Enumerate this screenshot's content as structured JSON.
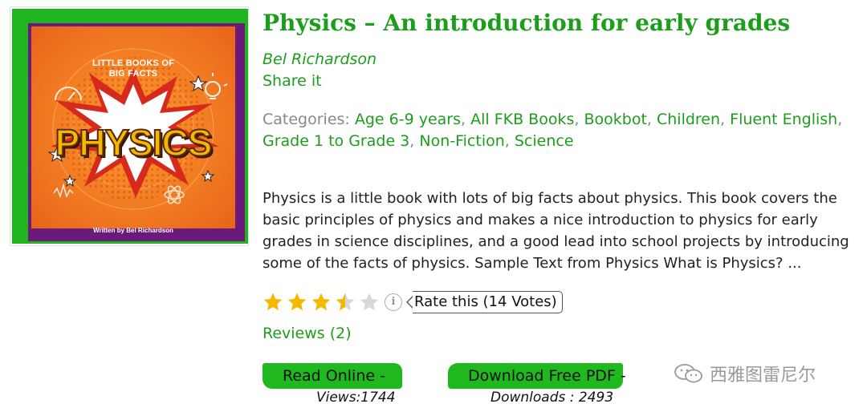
{
  "cover": {
    "series_line1": "LITTLE BOOKS OF",
    "series_line2": "BIG FACTS",
    "title": "PHYSICS",
    "author_line": "Written by Bel Richardson"
  },
  "book": {
    "title": "Physics – An introduction for early grades",
    "author": "Bel Richardson",
    "share_label": "Share it"
  },
  "categories": {
    "label": "Categories:",
    "items": [
      "Age 6-9 years",
      "All FKB Books",
      "Bookbot",
      "Children",
      "Fluent English",
      "Grade 1 to Grade 3",
      "Non-Fiction",
      "Science"
    ]
  },
  "description": "Physics is a little book with lots of big facts about physics. This book covers the basic principles of physics and makes a nice introduction to physics for early grades in science disciplines, and a good lead into school projects by introducing some of the facts of physics. Sample Text from Physics What is Physics? ...",
  "rating": {
    "value": 3.5,
    "max": 5,
    "info_icon": "i",
    "rate_label": "Rate this (14 Votes)"
  },
  "reviews_label": "Reviews (2)",
  "actions": {
    "read_label": "Read Online -",
    "views_text": "Views:1744",
    "download_label": "Download Free PDF -",
    "downloads_text": "Downloads : 2493"
  },
  "watermark": {
    "text": "西雅图雷尼尔",
    "icon": "wechat-icon"
  },
  "colors": {
    "accent_green": "#1c9e1c",
    "button_green": "#1fb81f",
    "star_filled": "#f5b800",
    "star_empty": "#d8d8d8",
    "cover_orange": "#f07a1e",
    "cover_purple": "#6b1a7b"
  }
}
